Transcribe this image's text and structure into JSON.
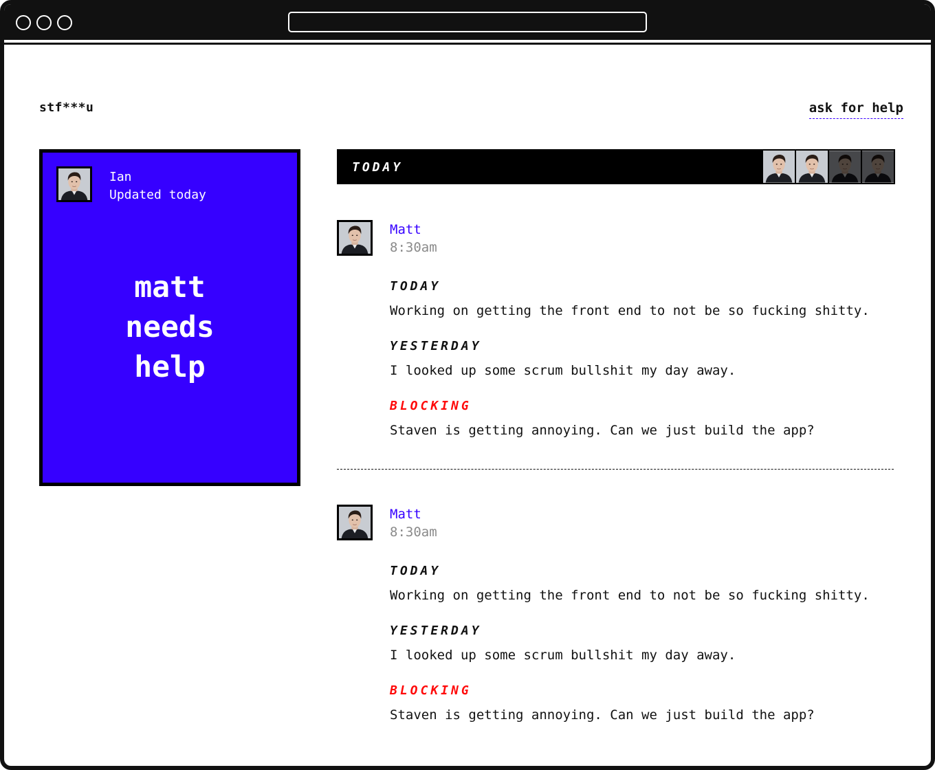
{
  "header": {
    "logo": "stf***u",
    "help_link": "ask for help"
  },
  "status_card": {
    "name": "Ian",
    "updated": "Updated today",
    "message_lines": [
      "matt",
      "needs",
      "help"
    ],
    "background_color": "#3600ff"
  },
  "day_bar": {
    "label": "TODAY",
    "member_count": 4
  },
  "updates": [
    {
      "author": "Matt",
      "time": "8:30am",
      "today_label": "TODAY",
      "today_text": "Working on getting the front end to not be so fucking shitty.",
      "yesterday_label": "YESTERDAY",
      "yesterday_text": "I looked up some scrum bullshit my day away.",
      "blocking_label": "BLOCKING",
      "blocking_text": "Staven is getting annoying. Can we just build the app?"
    },
    {
      "author": "Matt",
      "time": "8:30am",
      "today_label": "TODAY",
      "today_text": "Working on getting the front end to not be so fucking shitty.",
      "yesterday_label": "YESTERDAY",
      "yesterday_text": "I looked up some scrum bullshit my day away.",
      "blocking_label": "BLOCKING",
      "blocking_text": "Staven is getting annoying. Can we just build the app?"
    }
  ],
  "colors": {
    "accent": "#3600ff",
    "blocking": "#ff0a0a",
    "muted": "#8a8a8a"
  },
  "icons": {
    "avatar": "person-portrait-icon"
  }
}
